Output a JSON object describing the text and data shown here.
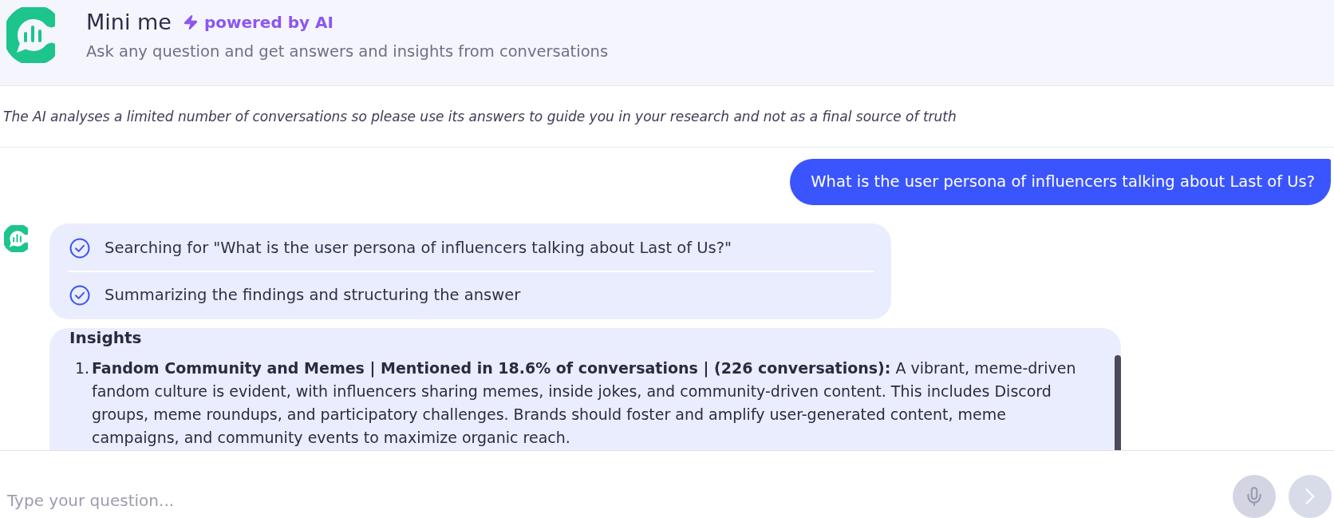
{
  "header": {
    "title": "Mini me",
    "badge": "powered by AI",
    "subtitle": "Ask any question and get answers and insights from conversations"
  },
  "disclaimer": "The AI analyses a limited number of conversations so please use its answers to guide you in your research and not as a final source of truth",
  "messages": [
    {
      "kind": "user",
      "text": "What is the user persona of influencers talking about Last of Us?"
    },
    {
      "kind": "bot",
      "blocks": [
        {
          "kind": "steps",
          "steps": [
            {
              "text": "Searching for \"What is the user persona of influencers talking about Last of Us?\"",
              "done": true
            },
            {
              "text": "Summarizing the findings and structuring the answer",
              "done": true
            }
          ]
        },
        {
          "kind": "insights",
          "title": "Insights",
          "items": [
            {
              "number": "1.",
              "text": "**Fandom Community and Memes | Mentioned in 18.6% of conversations | (226 conversations):** A vibrant, meme-driven fandom culture is evident, with influencers sharing memes, inside jokes, and community-driven content. This includes Discord groups, meme roundups, and participatory challenges. Brands should foster and amplify user-generated content, meme campaigns, and community events to maximize organic reach."
            }
          ]
        }
      ]
    }
  ],
  "composer": {
    "placeholder": "Type your question..."
  }
}
